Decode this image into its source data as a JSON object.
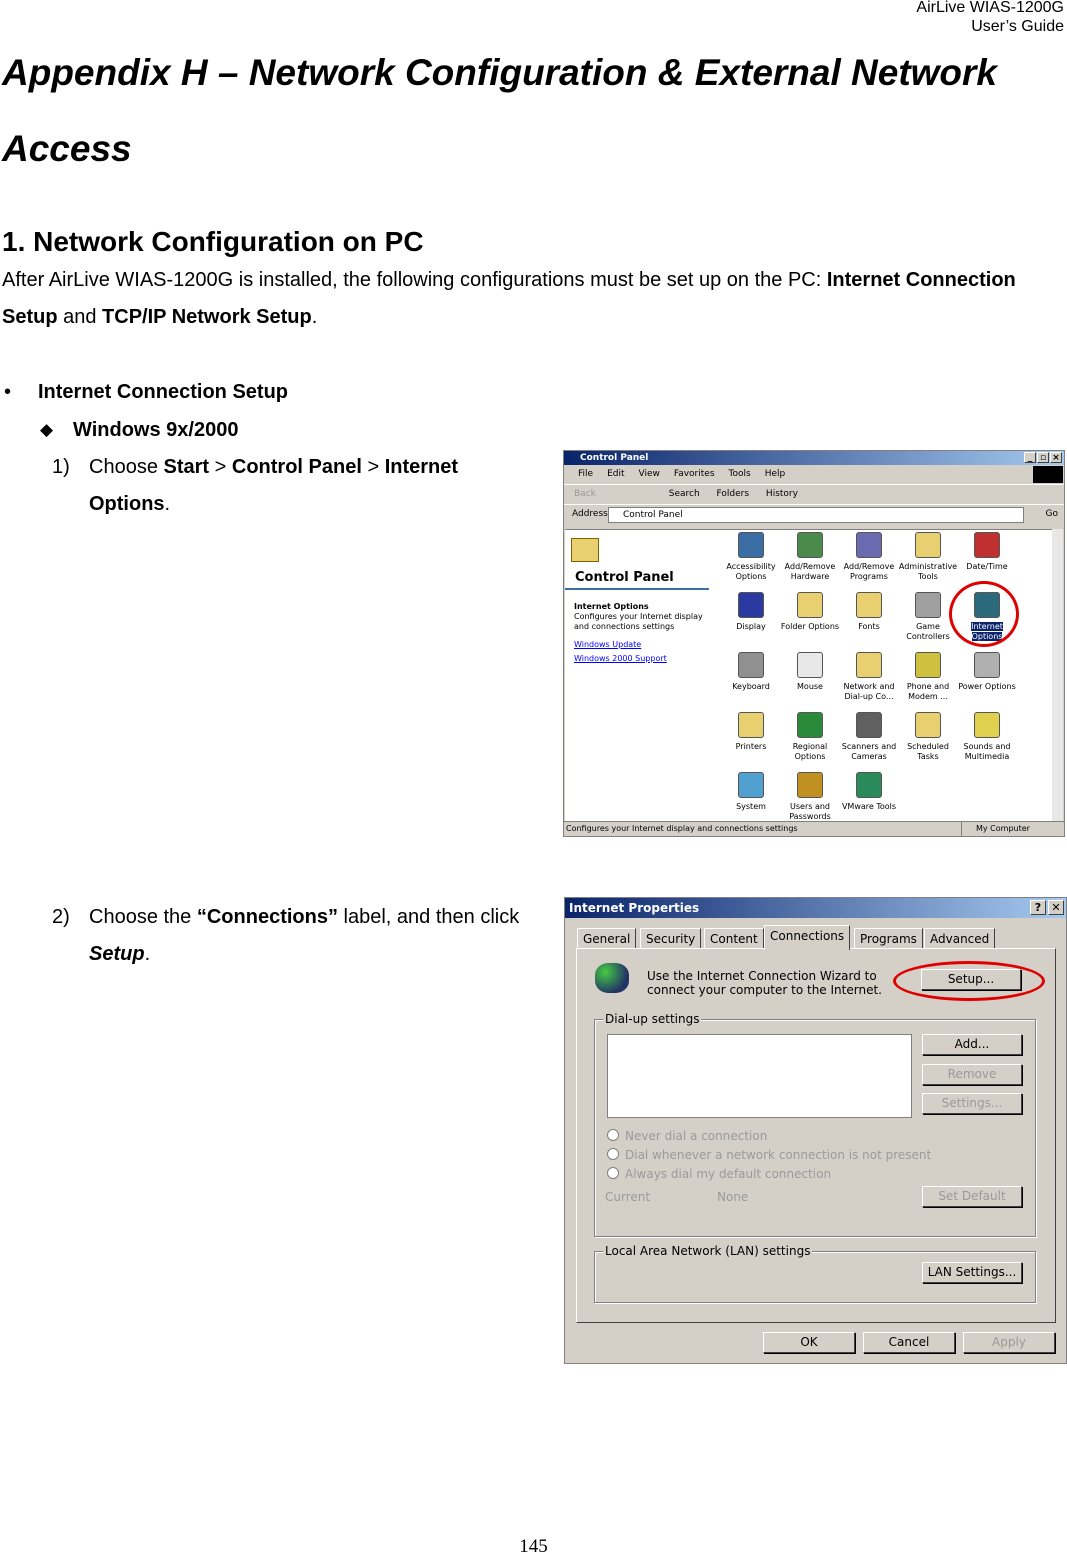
{
  "header": {
    "line1": "AirLive  WIAS-1200G",
    "line2": "User’s  Guide"
  },
  "title": {
    "line1": "Appendix H – Network Configuration & External Network",
    "line2": "Access"
  },
  "section": {
    "heading": "1.   Network Configuration on PC",
    "intro_pre": "After AirLive WIAS-1200G is installed, the following configurations must be set up on the PC: ",
    "intro_b1": "Internet Connection",
    "intro_b1b": "Setup",
    "intro_mid": " and ",
    "intro_b2": "TCP/IP Network Setup",
    "intro_end": "."
  },
  "bullet": {
    "symbol": "•",
    "label": "Internet Connection Setup"
  },
  "sub": {
    "symbol": "◆",
    "label": "Windows 9x/2000"
  },
  "step1": {
    "num": "1)",
    "pre": "Choose ",
    "b1": "Start",
    "sep1": " > ",
    "b2": "Control Panel",
    "sep2": " > ",
    "b3": "Internet",
    "b3b": "Options",
    "end": "."
  },
  "step2": {
    "num": "2)",
    "pre": "Choose the ",
    "b1": "“Connections”",
    "mid": " label, and then click",
    "b2": "Setup",
    "end": "."
  },
  "control_panel": {
    "title": "Control Panel",
    "menu": [
      "File",
      "Edit",
      "View",
      "Favorites",
      "Tools",
      "Help"
    ],
    "toolbar": {
      "back": "Back",
      "search": "Search",
      "folders": "Folders",
      "history": "History"
    },
    "address_label": "Address",
    "address_value": "Control Panel",
    "go": "Go",
    "side_title": "Control Panel",
    "side_item_title": "Internet Options",
    "side_item_desc": "Configures your Internet display and connections settings",
    "links": [
      "Windows Update",
      "Windows 2000 Support"
    ],
    "items": [
      {
        "label": "Accessibility Options",
        "color": "#3a6ea5"
      },
      {
        "label": "Add/Remove Hardware",
        "color": "#4a8a4a"
      },
      {
        "label": "Add/Remove Programs",
        "color": "#6a6ab0"
      },
      {
        "label": "Administrative Tools",
        "color": "#e8d070"
      },
      {
        "label": "Date/Time",
        "color": "#c03030"
      },
      {
        "label": "Display",
        "color": "#2a3aa0"
      },
      {
        "label": "Folder Options",
        "color": "#e8d070"
      },
      {
        "label": "Fonts",
        "color": "#e8d070"
      },
      {
        "label": "Game Controllers",
        "color": "#a0a0a0"
      },
      {
        "label": "Internet Options",
        "color": "#2a6a7a",
        "selected": true
      },
      {
        "label": "Keyboard",
        "color": "#909090"
      },
      {
        "label": "Mouse",
        "color": "#e8e8e8"
      },
      {
        "label": "Network and Dial-up Co...",
        "color": "#e8d070"
      },
      {
        "label": "Phone and Modem ...",
        "color": "#d0c040"
      },
      {
        "label": "Power Options",
        "color": "#b0b0b0"
      },
      {
        "label": "Printers",
        "color": "#e8d070"
      },
      {
        "label": "Regional Options",
        "color": "#2a8a3a"
      },
      {
        "label": "Scanners and Cameras",
        "color": "#606060"
      },
      {
        "label": "Scheduled Tasks",
        "color": "#e8d070"
      },
      {
        "label": "Sounds and Multimedia",
        "color": "#e0d050"
      },
      {
        "label": "System",
        "color": "#50a0d0"
      },
      {
        "label": "Users and Passwords",
        "color": "#c09020"
      },
      {
        "label": "VMware Tools",
        "color": "#2a8a5a"
      }
    ],
    "status": "Configures your Internet display and connections settings",
    "status_zone": "My Computer",
    "highlight_color": "#e00000"
  },
  "internet_properties": {
    "title": "Internet Properties",
    "help": "?",
    "close": "✕",
    "tabs": [
      "General",
      "Security",
      "Content",
      "Connections",
      "Programs",
      "Advanced"
    ],
    "active_tab": "Connections",
    "wizard_text1": "Use the Internet Connection Wizard to",
    "wizard_text2": "connect your computer to the Internet.",
    "setup": "Setup...",
    "dialup_group": "Dial-up settings",
    "add": "Add...",
    "remove": "Remove",
    "settings": "Settings...",
    "radios": [
      "Never dial a connection",
      "Dial whenever a network connection is not present",
      "Always dial my default connection"
    ],
    "current_label": "Current",
    "current_value": "None",
    "set_default": "Set Default",
    "lan_group": "Local Area Network (LAN) settings",
    "lan_settings": "LAN Settings...",
    "ok": "OK",
    "cancel": "Cancel",
    "apply": "Apply"
  },
  "page_number": "145"
}
